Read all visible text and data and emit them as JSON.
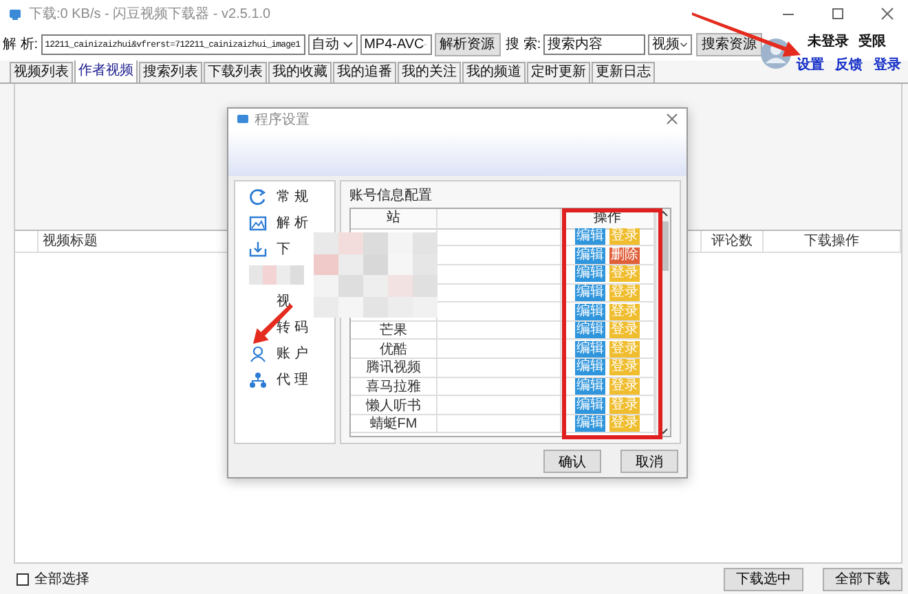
{
  "window": {
    "title": "下载:0 KB/s - 闪豆视频下载器 - v2.5.1.0"
  },
  "toolbar": {
    "parse_label": "解 析:",
    "url_value": "12211_cainizaizhui&vfrerst=712211_cainizaizhui_image1",
    "mode_select": "自动",
    "format_select": "MP4-AVC",
    "parse_button": "解析资源",
    "search_label": "搜 索:",
    "search_value": "搜索内容",
    "type_select": "视频",
    "search_button": "搜索资源"
  },
  "account": {
    "status": "未登录",
    "limit": "受限",
    "links": [
      "设置",
      "反馈",
      "登录"
    ]
  },
  "tabs": [
    {
      "label": "视频列表",
      "selected": false
    },
    {
      "label": "作者视频",
      "selected": true
    },
    {
      "label": "搜索列表",
      "selected": false
    },
    {
      "label": "下载列表",
      "selected": false
    },
    {
      "label": "我的收藏",
      "selected": false
    },
    {
      "label": "我的追番",
      "selected": false
    },
    {
      "label": "我的关注",
      "selected": false
    },
    {
      "label": "我的频道",
      "selected": false
    },
    {
      "label": "定时更新",
      "selected": false
    },
    {
      "label": "更新日志",
      "selected": false
    }
  ],
  "table": {
    "columns": [
      "视频标题",
      "评论数",
      "下载操作"
    ]
  },
  "footer": {
    "select_all": {
      "label": "全部选择",
      "checked": false
    },
    "buttons": [
      "下载选中",
      "全部下载"
    ]
  },
  "dialog": {
    "title": "程序设置",
    "nav": [
      {
        "label": "常 规",
        "kind": "general"
      },
      {
        "label": "解 析",
        "kind": "parse"
      },
      {
        "label": "下",
        "kind": "download"
      },
      {
        "kind": "blurred"
      },
      {
        "label": "视"
      },
      {
        "label": "转 码"
      },
      {
        "label": "账 户",
        "kind": "account"
      },
      {
        "label": "代 理",
        "kind": "proxy"
      }
    ],
    "group_title": "账号信息配置",
    "table": {
      "columns": [
        "站",
        "操作"
      ],
      "rows": [
        {
          "actions": [
            {
              "label": "编辑",
              "kind": "edit"
            },
            {
              "label": "登录",
              "kind": "login"
            }
          ]
        },
        {
          "actions": [
            {
              "label": "编辑",
              "kind": "edit"
            },
            {
              "label": "删除",
              "kind": "delete"
            }
          ]
        },
        {
          "actions": [
            {
              "label": "编辑",
              "kind": "edit"
            },
            {
              "label": "登录",
              "kind": "login"
            }
          ]
        },
        {
          "actions": [
            {
              "label": "编辑",
              "kind": "edit"
            },
            {
              "label": "登录",
              "kind": "login"
            }
          ]
        },
        {
          "actions": [
            {
              "label": "编辑",
              "kind": "edit"
            },
            {
              "label": "登录",
              "kind": "login"
            }
          ]
        },
        {
          "name": "芒果",
          "actions": [
            {
              "label": "编辑",
              "kind": "edit"
            },
            {
              "label": "登录",
              "kind": "login"
            }
          ]
        },
        {
          "name": "优酷",
          "actions": [
            {
              "label": "编辑",
              "kind": "edit"
            },
            {
              "label": "登录",
              "kind": "login"
            }
          ]
        },
        {
          "name": "腾讯视频",
          "actions": [
            {
              "label": "编辑",
              "kind": "edit"
            },
            {
              "label": "登录",
              "kind": "login"
            }
          ]
        },
        {
          "name": "喜马拉雅",
          "actions": [
            {
              "label": "编辑",
              "kind": "edit"
            },
            {
              "label": "登录",
              "kind": "login"
            }
          ]
        },
        {
          "name": "懒人听书",
          "actions": [
            {
              "label": "编辑",
              "kind": "edit"
            },
            {
              "label": "登录",
              "kind": "login"
            }
          ]
        },
        {
          "name": "蜻蜓FM",
          "actions": [
            {
              "label": "编辑",
              "kind": "edit"
            },
            {
              "label": "登录",
              "kind": "login"
            }
          ]
        }
      ]
    },
    "buttons": [
      "确认",
      "取消"
    ]
  }
}
